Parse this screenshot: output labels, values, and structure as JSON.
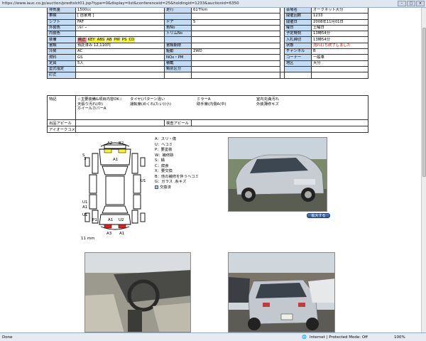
{
  "browser": {
    "url": "https://www.iauc.co.jp/auction/predtslct01.jsp?type=0&display=list&conferenceid=25&holdingid=1233&auctionid=6350",
    "status_left": "Done",
    "zone": "Internet | Protected Mode: Off",
    "zoom": "100%"
  },
  "spec_rows": [
    {
      "cells": [
        {
          "t": "排気量",
          "c": "lbl"
        },
        {
          "t": "1500cc"
        },
        {
          "t": "走行",
          "c": "lbl"
        },
        {
          "t": "61千km"
        },
        {
          "t": "",
          "c": "gap"
        },
        {
          "t": "会場名",
          "c": "lbl"
        },
        {
          "t": "オークネット大分"
        }
      ]
    },
    {
      "cells": [
        {
          "t": "車検",
          "c": "lbl"
        },
        {
          "t": "[ 自家用 ]"
        },
        {
          "t": "",
          "c": "lbl"
        },
        {
          "t": ""
        },
        {
          "t": "",
          "c": "gap"
        },
        {
          "t": "開催回数",
          "c": "lbl"
        },
        {
          "t": "1233"
        }
      ]
    },
    {
      "cells": [
        {
          "t": "シフト",
          "c": "lbl"
        },
        {
          "t": "FAT"
        },
        {
          "t": "ドア",
          "c": "lbl"
        },
        {
          "t": "5"
        },
        {
          "t": "",
          "c": "gap"
        },
        {
          "t": "開催日",
          "c": "lbl"
        },
        {
          "t": "2008年11月01日"
        }
      ]
    },
    {
      "cells": [
        {
          "t": "外装色",
          "c": "lbl"
        },
        {
          "t": "ｼﾙﾊﾞｰ"
        },
        {
          "t": "色No",
          "c": "lbl"
        },
        {
          "t": ""
        },
        {
          "t": "",
          "c": "gap"
        },
        {
          "t": "曜日",
          "c": "lbl"
        },
        {
          "t": "土曜日"
        }
      ]
    },
    {
      "cells": [
        {
          "t": "内装色",
          "c": "lbl"
        },
        {
          "t": ""
        },
        {
          "t": "トリムNo",
          "c": "lbl"
        },
        {
          "t": ""
        },
        {
          "t": "",
          "c": "gap"
        },
        {
          "t": "予定時刻",
          "c": "lbl"
        },
        {
          "t": "13時54分"
        }
      ]
    },
    {
      "cells": [
        {
          "t": "装備",
          "c": "lbl"
        },
        {
          "t": "__EQUIP__"
        },
        {
          "t": "",
          "c": "lbl"
        },
        {
          "t": ""
        },
        {
          "t": "",
          "c": "gap"
        },
        {
          "t": "入札締切",
          "c": "lbl"
        },
        {
          "t": "13時54分"
        }
      ]
    },
    {
      "cells": [
        {
          "t": "書類",
          "c": "lbl"
        },
        {
          "t": "預託済み 12,110円"
        },
        {
          "t": "書類期限",
          "c": "lbl"
        },
        {
          "t": ""
        },
        {
          "t": "",
          "c": "gap"
        },
        {
          "t": "状態",
          "c": "lbl"
        },
        {
          "t": "流れ打ち終了しました",
          "c": "red"
        }
      ]
    },
    {
      "cells": [
        {
          "t": "冷房",
          "c": "lbl"
        },
        {
          "t": "AC"
        },
        {
          "t": "駆動",
          "c": "lbl"
        },
        {
          "t": "2WD"
        },
        {
          "t": "",
          "c": "gap"
        },
        {
          "t": "チャンネル",
          "c": "lbl"
        },
        {
          "t": "B"
        }
      ]
    },
    {
      "cells": [
        {
          "t": "燃料",
          "c": "lbl"
        },
        {
          "t": "GS"
        },
        {
          "t": "NOx・PM",
          "c": "lbl"
        },
        {
          "t": ""
        },
        {
          "t": "",
          "c": "gap"
        },
        {
          "t": "コーナー",
          "c": "lbl"
        },
        {
          "t": "一般車"
        }
      ]
    },
    {
      "cells": [
        {
          "t": "定員",
          "c": "lbl"
        },
        {
          "t": "5人"
        },
        {
          "t": "積載",
          "c": "lbl"
        },
        {
          "t": ""
        },
        {
          "t": "",
          "c": "gap"
        },
        {
          "t": "地区",
          "c": "lbl"
        },
        {
          "t": "大分"
        }
      ]
    },
    {
      "cells": [
        {
          "t": "型式指定",
          "c": "lbl"
        },
        {
          "t": ""
        },
        {
          "t": "類別区分",
          "c": "lbl"
        },
        {
          "t": ""
        },
        {
          "t": "",
          "c": "gap"
        },
        {
          "t": "",
          "c": "lbl"
        },
        {
          "t": ""
        }
      ]
    },
    {
      "cells": [
        {
          "t": "訂正",
          "c": "lbl"
        },
        {
          "t": ""
        },
        {
          "t": ""
        },
        {
          "t": ""
        },
        {
          "t": ""
        },
        {
          "t": ""
        },
        {
          "t": ""
        }
      ]
    }
  ],
  "equipment": {
    "yellow": [
      "KEY",
      "ABS",
      "AB",
      "PW",
      "PS"
    ],
    "red": [
      "純正"
    ],
    "extra": "CD",
    "prefix": "装備"
  },
  "notes": {
    "features_label": "特記",
    "features": [
      "☆主要装備&項目内容OK☆",
      "タイヤ(パターン違い",
      "ミラーA",
      "室内充満汚れ",
      "天張り汚れ(中)",
      "運転席(めくれ(たい)(小)",
      "助手席(内側A(中)",
      "外装薄修キズ",
      "ホイールカバーA",
      "",
      "",
      ""
    ],
    "appeal_label": "出品アピール",
    "inspect_label": "検査アピール",
    "comment_label": "アイオークコメント"
  },
  "legend": {
    "items": [
      "A：スリ・傷",
      "U：ヘコミ",
      "P：要塗装",
      "W：補修跡",
      "S：錆",
      "C：腐食",
      "X：要交換",
      "B：他の補修を伴うヘコミ",
      "G：ガラス .糸キズ"
    ],
    "check_label": "交換済"
  },
  "diagram_labels": {
    "a2": "A2",
    "b2": "B2",
    "a1": "A1",
    "s3": "S",
    "n3": "3",
    "u1a": "U1",
    "u1b": "U1",
    "a1b": "A1",
    "u1c": "U1",
    "p1": "P1",
    "a1c": "A1",
    "u2": "U2",
    "a3": "A3",
    "a1d": "A1",
    "mm": "11 mm"
  },
  "buttons": {
    "zoom": "拡大する"
  }
}
